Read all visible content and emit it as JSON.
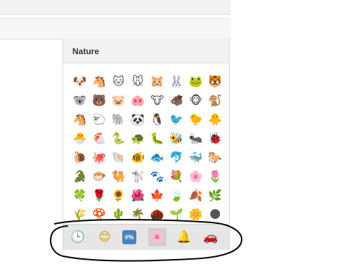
{
  "panel": {
    "title": "Nature"
  },
  "emoji_grid": [
    "🐶",
    "🐴",
    "🐱",
    "🐭",
    "🐹",
    "🐰",
    "🐸",
    "🐯",
    "🐨",
    "🐻",
    "🐷",
    "🐽",
    "🐮",
    "🐗",
    "🐵",
    "🐒",
    "🐴",
    "🐑",
    "🐘",
    "🐼",
    "🐧",
    "🐦",
    "🐤",
    "🐥",
    "🐣",
    "🐔",
    "🐍",
    "🐢",
    "🐛",
    "🐝",
    "🐜",
    "🐞",
    "🐌",
    "🐙",
    "🐚",
    "🐠",
    "🐟",
    "🐬",
    "🐳",
    "🐎",
    "🐊",
    "🐡",
    "🐫",
    "🐩",
    "🐾",
    "💐",
    "🌸",
    "🌷",
    "🍀",
    "🌹",
    "🌻",
    "🌺",
    "🍁",
    "🍃",
    "🍂",
    "🌿",
    "🌾",
    "🍄",
    "🌵",
    "🌴",
    "🌰",
    "🌱",
    "🌼",
    "🌑"
  ],
  "toolbar": {
    "clock_icon": "🕒",
    "smile_icon": "😊",
    "symbols_icon": "#%",
    "flower_icon": "🌸",
    "bell_icon": "🔔",
    "car_icon": "🚗"
  },
  "annotation_color": "#000000"
}
